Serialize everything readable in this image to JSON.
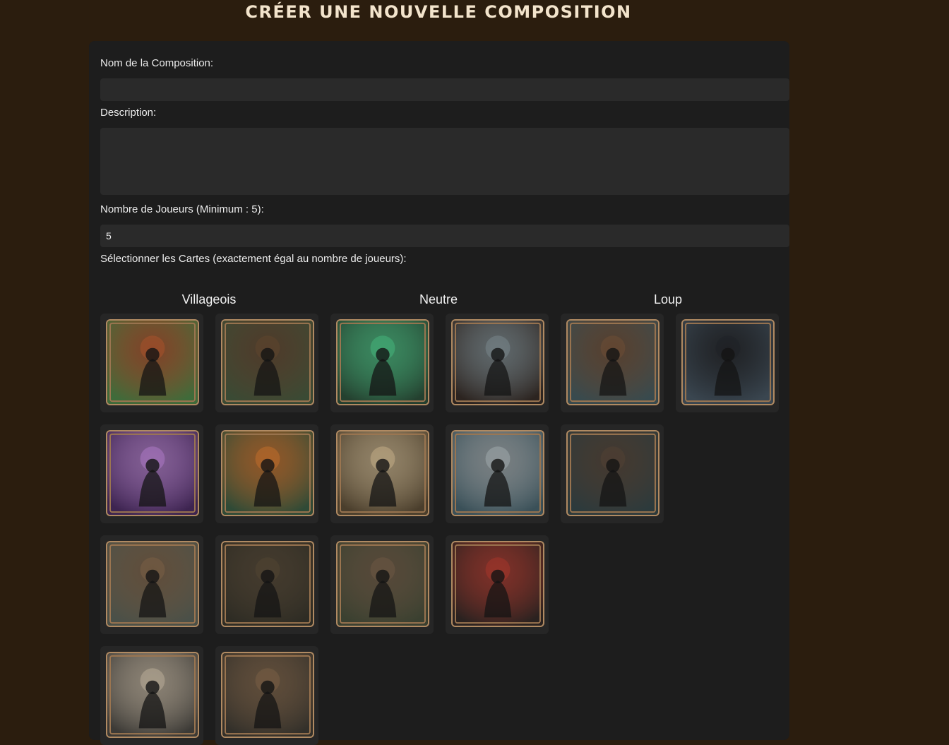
{
  "page": {
    "title": "CRÉER UNE NOUVELLE COMPOSITION"
  },
  "form": {
    "name_label": "Nom de la Composition:",
    "name_value": "",
    "description_label": "Description:",
    "description_value": "",
    "players_label": "Nombre de Joueurs (Minimum : 5):",
    "players_value": "5",
    "cards_label": "Sélectionner les Cartes (exactement égal au nombre de joueurs):"
  },
  "categories": [
    {
      "label": "Villageois"
    },
    {
      "label": "Neutre"
    },
    {
      "label": "Loup"
    }
  ],
  "cards": [
    {
      "icon": "fox-card-icon",
      "palette": [
        "#3f6b3a",
        "#c2582a"
      ]
    },
    {
      "icon": "hunters-trio-card-icon",
      "palette": [
        "#3a4a34",
        "#6b4a2e"
      ]
    },
    {
      "icon": "flute-player-card-icon",
      "palette": [
        "#24402f",
        "#4bd18b"
      ]
    },
    {
      "icon": "moonlit-child-card-icon",
      "palette": [
        "#2c2420",
        "#8a9aa0"
      ]
    },
    {
      "icon": "brown-werewolf-card-icon",
      "palette": [
        "#384a4e",
        "#7a5336"
      ]
    },
    {
      "icon": "black-werewolf-moon-card-icon",
      "palette": [
        "#3a4650",
        "#1c1f24"
      ]
    },
    {
      "icon": "seer-crystal-ball-card-icon",
      "palette": [
        "#3d2450",
        "#c88ae6"
      ]
    },
    {
      "icon": "witch-cauldron-card-icon",
      "palette": [
        "#2f4a36",
        "#e07a2a"
      ]
    },
    {
      "icon": "angel-card-icon",
      "palette": [
        "#4a3e2c",
        "#e2c89a"
      ]
    },
    {
      "icon": "white-werewolf-card-icon",
      "palette": [
        "#3a5058",
        "#b8c2c6"
      ]
    },
    {
      "icon": "werewolf-pack-card-icon",
      "palette": [
        "#2c3a3c",
        "#5a4636"
      ]
    },
    {
      "icon": "villager-pitchfork-card-icon",
      "palette": [
        "#4a5048",
        "#8a6a4a"
      ]
    },
    {
      "icon": "hooded-thief-card-icon",
      "palette": [
        "#2e2c24",
        "#5a4a34"
      ]
    },
    {
      "icon": "wolf-dog-card-icon",
      "palette": [
        "#3a4030",
        "#7a6248"
      ]
    },
    {
      "icon": "cult-leader-card-icon",
      "palette": [
        "#2a2220",
        "#c0392b"
      ]
    },
    {
      "icon": "cupid-card-icon",
      "palette": [
        "#3c3a36",
        "#d8c8b0"
      ]
    },
    {
      "icon": "knight-sword-card-icon",
      "palette": [
        "#33302a",
        "#8a6a4a"
      ]
    }
  ]
}
